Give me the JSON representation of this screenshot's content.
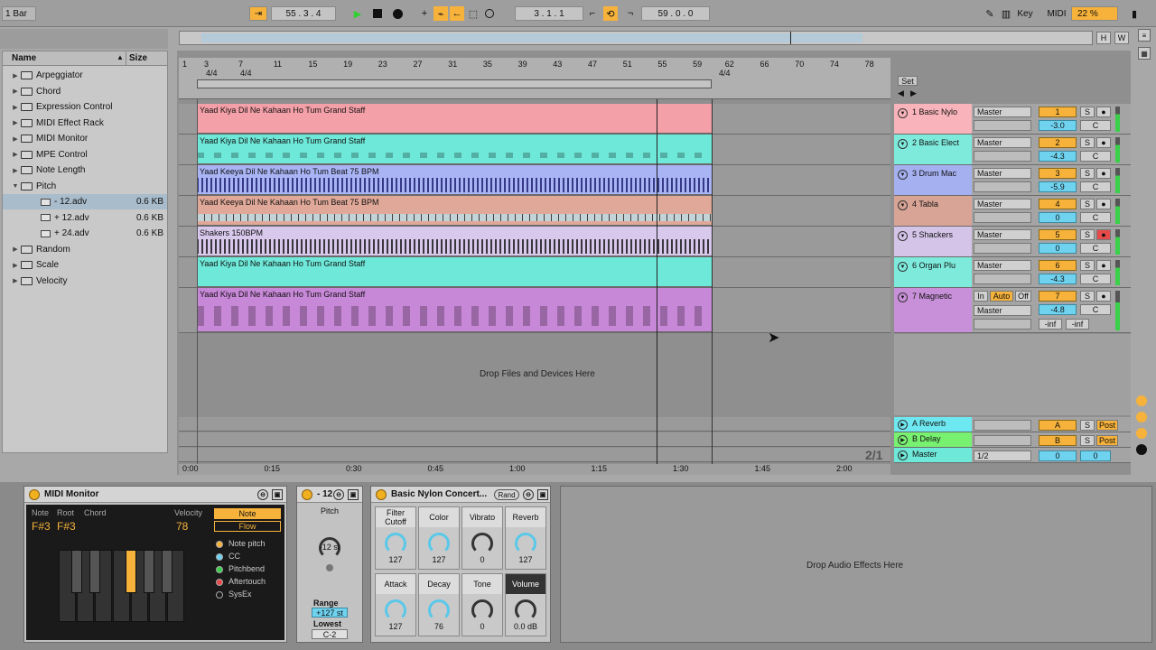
{
  "transport": {
    "quantize": "1 Bar",
    "tempo": "55 . 3 . 4",
    "position": "3 . 1 . 1",
    "length": "59 . 0 . 0",
    "key_label": "Key",
    "midi_label": "MIDI",
    "zoom": "22 %",
    "h_label": "H",
    "w_label": "W"
  },
  "browser": {
    "col_name": "Name",
    "col_size": "Size",
    "items": [
      {
        "label": "Arpeggiator",
        "type": "folder",
        "size": ""
      },
      {
        "label": "Chord",
        "type": "folder",
        "size": ""
      },
      {
        "label": "Expression Control",
        "type": "folder",
        "size": ""
      },
      {
        "label": "MIDI Effect Rack",
        "type": "folder",
        "size": ""
      },
      {
        "label": "MIDI Monitor",
        "type": "folder",
        "size": ""
      },
      {
        "label": "MPE Control",
        "type": "folder",
        "size": ""
      },
      {
        "label": "Note Length",
        "type": "folder",
        "size": ""
      },
      {
        "label": "Pitch",
        "type": "folder-open",
        "size": ""
      },
      {
        "label": "- 12.adv",
        "type": "file",
        "size": "0.6 KB"
      },
      {
        "label": "+ 12.adv",
        "type": "file",
        "size": "0.6 KB"
      },
      {
        "label": "+ 24.adv",
        "type": "file",
        "size": "0.6 KB"
      },
      {
        "label": "Random",
        "type": "folder",
        "size": ""
      },
      {
        "label": "Scale",
        "type": "folder",
        "size": ""
      },
      {
        "label": "Velocity",
        "type": "folder",
        "size": ""
      }
    ]
  },
  "ruler": {
    "bars": [
      "1",
      "3",
      "7",
      "11",
      "15",
      "19",
      "23",
      "27",
      "31",
      "35",
      "39",
      "43",
      "47",
      "51",
      "55",
      "59",
      "62",
      "66",
      "70",
      "74",
      "78"
    ],
    "sig1": "4/4",
    "sig2": "4/4",
    "sig3": "4/4",
    "time": [
      "0:00",
      "0:15",
      "0:30",
      "0:45",
      "1:00",
      "1:15",
      "1:30",
      "1:45",
      "2:00"
    ],
    "set_label": "Set",
    "page": "2/1"
  },
  "tracks": [
    {
      "clip": "Yaad Kiya Dil Ne Kahaan Ho Tum  Grand Staff",
      "name": "1 Basic Nylo",
      "out": "Master",
      "num": "1",
      "vol": "-3.0",
      "pan": "C",
      "color": "#f4a0a8",
      "tcolor": "#f8b4ba"
    },
    {
      "clip": "Yaad Kiya Dil Ne Kahaan Ho Tum  Grand Staff",
      "name": "2 Basic Elect",
      "out": "Master",
      "num": "2",
      "vol": "-4.3",
      "pan": "C",
      "color": "#6ee8d8",
      "tcolor": "#7eeadc"
    },
    {
      "clip": "Yaad Keeya Dil Ne Kahaan Ho Tum Beat 75 BPM",
      "name": "3 Drum Mac",
      "out": "Master",
      "num": "3",
      "vol": "-5.9",
      "pan": "C",
      "color": "#a8b4f4",
      "tcolor": "#a4b0f0"
    },
    {
      "clip": "Yaad Keeya Dil Ne Kahaan Ho Tum Beat 75 BPM",
      "name": "4 Tabla",
      "out": "Master",
      "num": "4",
      "vol": "0",
      "pan": "C",
      "color": "#e0a898",
      "tcolor": "#d8a496"
    },
    {
      "clip": "Shakers 150BPM",
      "name": "5 Shackers",
      "out": "Master",
      "num": "5",
      "vol": "0",
      "pan": "C",
      "color": "#d8c8ec",
      "tcolor": "#d4c4e8"
    },
    {
      "clip": "Yaad Kiya Dil Ne Kahaan Ho Tum  Grand Staff",
      "name": "6 Organ Plu",
      "out": "Master",
      "num": "6",
      "vol": "-4.3",
      "pan": "C",
      "color": "#6ee8d8",
      "tcolor": "#7eeadc"
    },
    {
      "clip": "Yaad Kiya Dil Ne Kahaan Ho Tum  Grand Staff",
      "name": "7 Magnetic",
      "out": "Master",
      "num": "7",
      "vol": "-4.8",
      "pan": "C",
      "color": "#c888d8",
      "tcolor": "#c890d8"
    }
  ],
  "track7_extra": {
    "in": "In",
    "auto": "Auto",
    "off": "Off",
    "inf1": "-inf",
    "inf2": "-inf"
  },
  "drop_files": "Drop Files and Devices Here",
  "returns": [
    {
      "name": "A Reverb",
      "num": "A",
      "post": "Post",
      "color": "#6ee8f0"
    },
    {
      "name": "B Delay",
      "num": "B",
      "post": "Post",
      "color": "#78f070"
    },
    {
      "name": "Master",
      "num": "0",
      "post": "0",
      "color": "#6ee8d8",
      "sel": "1/2"
    }
  ],
  "solo_label": "S",
  "devices": {
    "midi_monitor": {
      "title": "MIDI Monitor",
      "note_label": "Note",
      "root_label": "Root",
      "chord_label": "Chord",
      "velocity_label": "Velocity",
      "note": "F#3",
      "root": "F#3",
      "velocity": "78",
      "btn_note": "Note",
      "btn_flow": "Flow",
      "legend": [
        "Note pitch",
        "CC",
        "Pitchbend",
        "Aftertouch",
        "SysEx"
      ]
    },
    "pitch": {
      "title": "- 12",
      "label": "Pitch",
      "value": "-12 st",
      "range_label": "Range",
      "range": "+127 st",
      "lowest_label": "Lowest",
      "lowest": "C-2"
    },
    "instrument": {
      "title": "Basic Nylon Concert...",
      "rand": "Rand",
      "macros": [
        {
          "label": "Filter Cutoff",
          "value": "127"
        },
        {
          "label": "Color",
          "value": "127"
        },
        {
          "label": "Vibrato",
          "value": "0"
        },
        {
          "label": "Reverb",
          "value": "127"
        },
        {
          "label": "Attack",
          "value": "127"
        },
        {
          "label": "Decay",
          "value": "76"
        },
        {
          "label": "Tone",
          "value": "0"
        },
        {
          "label": "Volume",
          "value": "0.0 dB"
        }
      ]
    },
    "drop_audio": "Drop Audio Effects Here"
  },
  "colors": {
    "accent": "#f6b23a",
    "cyan": "#6fd3f0",
    "play": "#2fd02f"
  }
}
